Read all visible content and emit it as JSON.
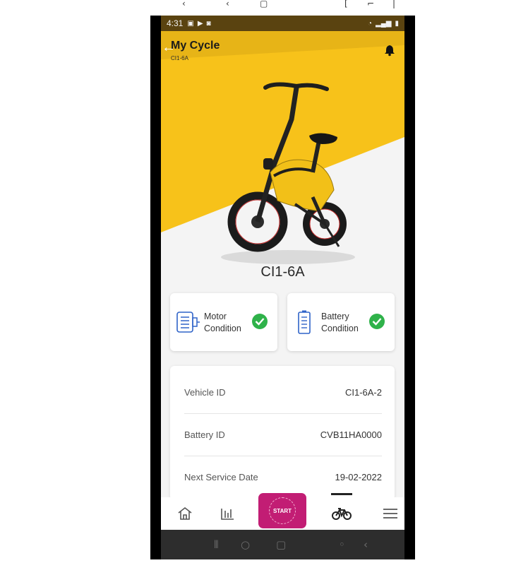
{
  "statusbar": {
    "time": "4:31"
  },
  "appbar": {
    "title": "My Cycle",
    "subtitle": "CI1-6A"
  },
  "cycle": {
    "model": "CI1-6A"
  },
  "conditions": [
    {
      "label_line1": "Motor",
      "label_line2": "Condition",
      "status": "ok"
    },
    {
      "label_line1": "Battery",
      "label_line2": "Condition",
      "status": "ok"
    }
  ],
  "details": [
    {
      "key": "Vehicle ID",
      "value": "CI1-6A-2"
    },
    {
      "key": "Battery ID",
      "value": "CVB11HA0000"
    },
    {
      "key": "Next Service Date",
      "value": "19-02-2022"
    }
  ],
  "bottom_nav": {
    "start_label": "START",
    "items": [
      "home-icon",
      "stats-icon",
      "start-button",
      "bicycle-icon",
      "menu-icon"
    ],
    "active": "bicycle-icon"
  },
  "colors": {
    "accent_yellow": "#f7c21a",
    "start_pink": "#c21d74",
    "check_green": "#2fb24a",
    "icon_blue": "#2f63c8"
  }
}
